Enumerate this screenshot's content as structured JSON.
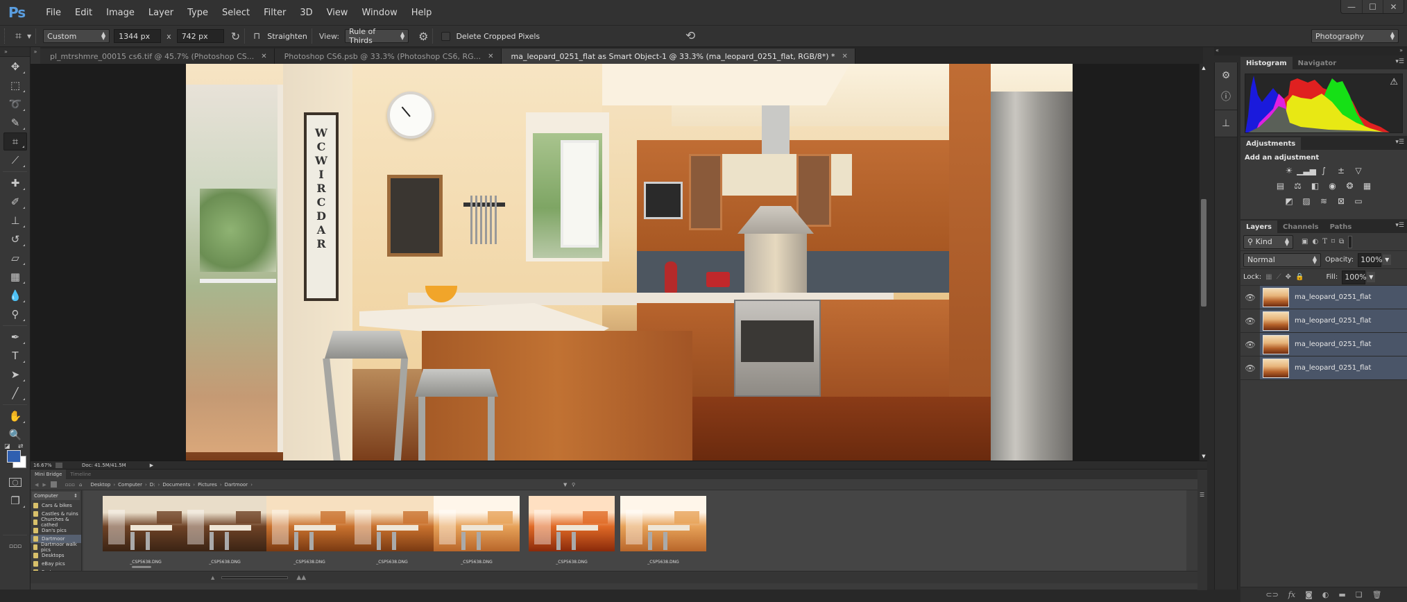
{
  "app": {
    "logo": "Ps",
    "menu": [
      "File",
      "Edit",
      "Image",
      "Layer",
      "Type",
      "Select",
      "Filter",
      "3D",
      "View",
      "Window",
      "Help"
    ],
    "window_controls": {
      "minimize": "—",
      "maximize": "☐",
      "close": "✕"
    }
  },
  "options_bar": {
    "tool_icon": "crop-icon",
    "ratio_preset": "Custom",
    "width": "1344 px",
    "times": "x",
    "height": "742 px",
    "straighten_label": "Straighten",
    "view_label": "View:",
    "view_value": "Rule of Thirds",
    "delete_cropped_label": "Delete Cropped Pixels",
    "delete_cropped_checked": false,
    "workspace": "Photography"
  },
  "document_tabs": [
    {
      "label": "pl_mtrshmre_00015 cs6.tif @ 45.7% (Photoshop CS...",
      "active": false
    },
    {
      "label": "Photoshop CS6.psb @ 33.3% (Photoshop CS6, RG...",
      "active": false
    },
    {
      "label": "ma_leopard_0251_flat as Smart Object-1 @ 33.3% (ma_leopard_0251_flat, RGB/8*) *",
      "active": true
    }
  ],
  "tools": [
    {
      "name": "move-tool",
      "glyph": "✥"
    },
    {
      "name": "marquee-tool",
      "glyph": "⬚"
    },
    {
      "name": "lasso-tool",
      "glyph": "➰"
    },
    {
      "name": "quick-selection-tool",
      "glyph": "✎"
    },
    {
      "name": "crop-tool",
      "glyph": "⌗"
    },
    {
      "name": "eyedropper-tool",
      "glyph": "⟋"
    },
    {
      "name": "healing-brush-tool",
      "glyph": "✚"
    },
    {
      "name": "brush-tool",
      "glyph": "✐"
    },
    {
      "name": "clone-stamp-tool",
      "glyph": "⊥"
    },
    {
      "name": "history-brush-tool",
      "glyph": "↺"
    },
    {
      "name": "eraser-tool",
      "glyph": "▱"
    },
    {
      "name": "gradient-tool",
      "glyph": "▦"
    },
    {
      "name": "blur-tool",
      "glyph": "💧"
    },
    {
      "name": "dodge-tool",
      "glyph": "⚲"
    },
    {
      "name": "pen-tool",
      "glyph": "✒"
    },
    {
      "name": "type-tool",
      "glyph": "T"
    },
    {
      "name": "path-selection-tool",
      "glyph": "➤"
    },
    {
      "name": "line-tool",
      "glyph": "╱"
    },
    {
      "name": "hand-tool",
      "glyph": "✋"
    },
    {
      "name": "zoom-tool",
      "glyph": "🔍"
    }
  ],
  "colors": {
    "foreground": "#2f5fb0",
    "background": "#ffffff",
    "selection_highlight": "#4a5568",
    "accent_logo": "#5a9ee0"
  },
  "status_bar": {
    "zoom": "16.67%",
    "doc": "Doc: 41.5M/41.5M"
  },
  "mini_bridge": {
    "tabs": [
      "Mini Bridge",
      "Timeline"
    ],
    "breadcrumb": [
      "Desktop",
      "Computer",
      "D:",
      "Documents",
      "Pictures",
      "Dartmoor"
    ],
    "location": "Computer",
    "folders": [
      {
        "label": "Cars & bikes",
        "selected": false
      },
      {
        "label": "Castles & ruins",
        "selected": false
      },
      {
        "label": "Churches & cathed",
        "selected": false
      },
      {
        "label": "Dan's pics",
        "selected": false
      },
      {
        "label": "Dartmoor",
        "selected": true
      },
      {
        "label": "Dartmoor walk pics",
        "selected": false
      },
      {
        "label": "Desktops",
        "selected": false
      },
      {
        "label": "eBay pics",
        "selected": false
      },
      {
        "label": "Faster",
        "selected": false
      }
    ],
    "thumbnails": [
      {
        "label": "_CSP5638.DNG",
        "tone": "dark"
      },
      {
        "label": "_CSP5638.DNG",
        "tone": "dark"
      },
      {
        "label": "_CSP5638.DNG",
        "tone": "warm"
      },
      {
        "label": "_CSP5638.DNG",
        "tone": "warm"
      },
      {
        "label": "_CSP5638.DNG",
        "tone": "bright"
      },
      {
        "label": "_CSP5638.DNG",
        "tone": "saturated"
      },
      {
        "label": "_CSP5638.DNG",
        "tone": "bright"
      }
    ]
  },
  "panels": {
    "histogram_tabs": [
      "Histogram",
      "Navigator"
    ],
    "adjustments_tab": "Adjustments",
    "adjustments_title": "Add an adjustment",
    "adjustment_rows": [
      [
        {
          "name": "brightness-contrast-icon",
          "glyph": "☀"
        },
        {
          "name": "levels-icon",
          "glyph": "▁▃▅"
        },
        {
          "name": "curves-icon",
          "glyph": "∫"
        },
        {
          "name": "exposure-icon",
          "glyph": "±"
        },
        {
          "name": "vibrance-icon",
          "glyph": "▽"
        }
      ],
      [
        {
          "name": "hue-saturation-icon",
          "glyph": "▤"
        },
        {
          "name": "color-balance-icon",
          "glyph": "⚖"
        },
        {
          "name": "black-white-icon",
          "glyph": "◧"
        },
        {
          "name": "photo-filter-icon",
          "glyph": "◉"
        },
        {
          "name": "channel-mixer-icon",
          "glyph": "❂"
        },
        {
          "name": "color-lookup-icon",
          "glyph": "▦"
        }
      ],
      [
        {
          "name": "invert-icon",
          "glyph": "◩"
        },
        {
          "name": "posterize-icon",
          "glyph": "▨"
        },
        {
          "name": "threshold-icon",
          "glyph": "≋"
        },
        {
          "name": "selective-color-icon",
          "glyph": "⊠"
        },
        {
          "name": "gradient-map-icon",
          "glyph": "▭"
        }
      ]
    ],
    "layers_tabs": [
      "Layers",
      "Channels",
      "Paths"
    ],
    "filter_kind": "Kind",
    "blend_mode": "Normal",
    "opacity_label": "Opacity:",
    "opacity": "100%",
    "lock_label": "Lock:",
    "fill_label": "Fill:",
    "fill": "100%",
    "layers": [
      {
        "name": "ma_leopard_0251_flat",
        "visible": true,
        "selected": true
      },
      {
        "name": "ma_leopard_0251_flat",
        "visible": true,
        "selected": true
      },
      {
        "name": "ma_leopard_0251_flat",
        "visible": true,
        "selected": true
      },
      {
        "name": "ma_leopard_0251_flat",
        "visible": true,
        "selected": true
      }
    ]
  }
}
